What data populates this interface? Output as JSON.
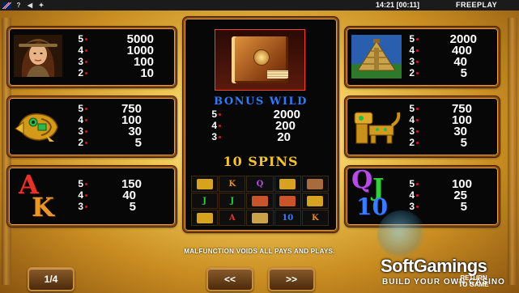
{
  "topbar": {
    "time": "14:21 [00:11]",
    "mode": "FREEPLAY",
    "icons": [
      "uk-flag-icon",
      "help-icon",
      "mute-icon",
      "settings-icon"
    ],
    "help_glyph": "?",
    "mute_glyph": "◀",
    "settings_glyph": "✦"
  },
  "paytable": {
    "woman": [
      {
        "count": "5",
        "amount": "5000"
      },
      {
        "count": "4",
        "amount": "1000"
      },
      {
        "count": "3",
        "amount": "100"
      },
      {
        "count": "2",
        "amount": "10"
      }
    ],
    "pyramid": [
      {
        "count": "5",
        "amount": "2000"
      },
      {
        "count": "4",
        "amount": "400"
      },
      {
        "count": "3",
        "amount": "40"
      },
      {
        "count": "2",
        "amount": "5"
      }
    ],
    "bird": [
      {
        "count": "5",
        "amount": "750"
      },
      {
        "count": "4",
        "amount": "100"
      },
      {
        "count": "3",
        "amount": "30"
      },
      {
        "count": "2",
        "amount": "5"
      }
    ],
    "jaguar": [
      {
        "count": "5",
        "amount": "750"
      },
      {
        "count": "4",
        "amount": "100"
      },
      {
        "count": "3",
        "amount": "30"
      },
      {
        "count": "2",
        "amount": "5"
      }
    ],
    "ak": [
      {
        "count": "5",
        "amount": "150"
      },
      {
        "count": "4",
        "amount": "40"
      },
      {
        "count": "3",
        "amount": "5"
      }
    ],
    "qj10": [
      {
        "count": "5",
        "amount": "100"
      },
      {
        "count": "4",
        "amount": "25"
      },
      {
        "count": "3",
        "amount": "5"
      }
    ],
    "book": [
      {
        "count": "5",
        "amount": "2000"
      },
      {
        "count": "4",
        "amount": "200"
      },
      {
        "count": "3",
        "amount": "20"
      }
    ]
  },
  "symbols": {
    "ak_top": "A",
    "ak_bottom": "K",
    "q": "Q",
    "j": "J",
    "ten": "10"
  },
  "center": {
    "bonus_title": "BONUS WILD",
    "spins_title": "10 SPINS"
  },
  "reel_grid": [
    {
      "glyph": "",
      "icon": "jaguar-icon",
      "color": "#d6a21f"
    },
    {
      "glyph": "K",
      "icon": "",
      "color": "#e08a2a"
    },
    {
      "glyph": "Q",
      "icon": "",
      "color": "#b44de0"
    },
    {
      "glyph": "",
      "icon": "jaguar-icon",
      "color": "#d6a21f"
    },
    {
      "glyph": "",
      "icon": "woman-icon",
      "color": "#a86b3c"
    },
    {
      "glyph": "J",
      "icon": "",
      "color": "#2fd03b"
    },
    {
      "glyph": "J",
      "icon": "",
      "color": "#2fd03b"
    },
    {
      "glyph": "",
      "icon": "book-icon",
      "color": "#c9542a"
    },
    {
      "glyph": "",
      "icon": "book-icon",
      "color": "#c9542a"
    },
    {
      "glyph": "",
      "icon": "jaguar-icon",
      "color": "#d6a21f"
    },
    {
      "glyph": "",
      "icon": "jaguar-icon",
      "color": "#d6a21f"
    },
    {
      "glyph": "A",
      "icon": "",
      "color": "#e0362a"
    },
    {
      "glyph": "",
      "icon": "pyramid-icon",
      "color": "#c9a24a"
    },
    {
      "glyph": "10",
      "icon": "",
      "color": "#3a7bff"
    },
    {
      "glyph": "K",
      "icon": "",
      "color": "#e08a2a"
    }
  ],
  "footer": {
    "notice": "MALFUNCTION VOIDS ALL PAYS AND PLAYS.",
    "page": "1/4",
    "prev": "<<",
    "next": ">>",
    "return_line1": "RETURN",
    "return_line2": "TO GAME"
  },
  "branding": {
    "name": "SoftGamings",
    "tagline": "BUILD YOUR OWN CASINO"
  },
  "colors": {
    "panel_border": "#8c4a10",
    "bonus_blue": "#2f7bff",
    "spins_gold": "#f4c32f",
    "pay_dot": "#d31a1a"
  }
}
